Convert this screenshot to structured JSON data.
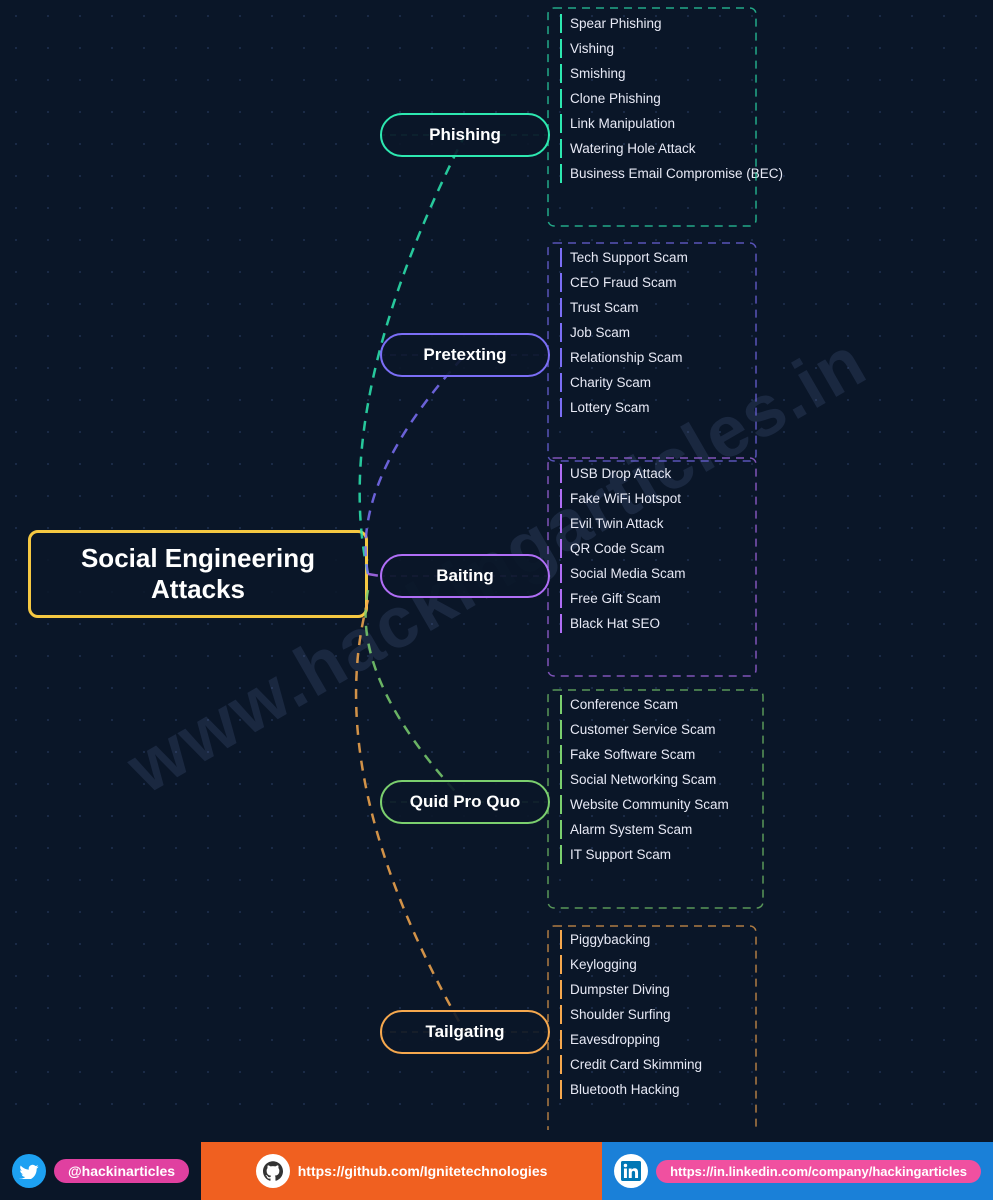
{
  "title": "Social Engineering Attacks",
  "watermark": "www.hackingarticles.in",
  "central": {
    "label": "Social Engineering Attacks"
  },
  "categories": [
    {
      "id": "phishing",
      "label": "Phishing",
      "color": "#2de8b0",
      "items": [
        "Spear Phishing",
        "Vishing",
        "Smishing",
        "Clone Phishing",
        "Link Manipulation",
        "Watering Hole Attack",
        "Business Email Compromise (BEC)"
      ]
    },
    {
      "id": "pretexting",
      "label": "Pretexting",
      "color": "#7b6ef6",
      "items": [
        "Tech Support Scam",
        "CEO Fraud Scam",
        "Trust Scam",
        "Job Scam",
        "Relationship Scam",
        "Charity Scam",
        "Lottery Scam"
      ]
    },
    {
      "id": "baiting",
      "label": "Baiting",
      "color": "#b06ef6",
      "items": [
        "USB Drop Attack",
        "Fake WiFi Hotspot",
        "Evil Twin Attack",
        "QR Code Scam",
        "Social Media Scam",
        "Free Gift Scam",
        "Black Hat SEO"
      ]
    },
    {
      "id": "quidproquo",
      "label": "Quid Pro Quo",
      "color": "#7bcf6e",
      "items": [
        "Conference Scam",
        "Customer Service Scam",
        "Fake Software Scam",
        "Social Networking Scam",
        "Website Community Scam",
        "Alarm System Scam",
        "IT Support Scam"
      ]
    },
    {
      "id": "tailgating",
      "label": "Tailgating",
      "color": "#f6a84e",
      "items": [
        "Piggybacking",
        "Keylogging",
        "Dumpster Diving",
        "Shoulder Surfing",
        "Eavesdropping",
        "Credit Card Skimming",
        "Bluetooth Hacking"
      ]
    }
  ],
  "footer": {
    "twitter_handle": "@hackinarticles",
    "github_url": "https://github.com/Ignitetechnologies",
    "linkedin_url": "https://in.linkedin.com/company/hackingarticles"
  }
}
